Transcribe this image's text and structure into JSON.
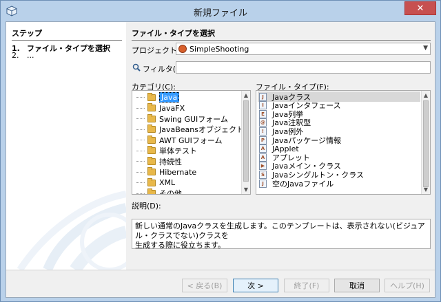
{
  "window": {
    "title": "新規ファイル",
    "close_glyph": "✕"
  },
  "steps": {
    "heading": "ステップ",
    "items": [
      {
        "num": "1.",
        "label": "ファイル・タイプを選択"
      },
      {
        "num": "2.",
        "label": "..."
      }
    ]
  },
  "main": {
    "heading": "ファイル・タイプを選択",
    "project_label": "プロジェクト(P):",
    "project_value": "SimpleShooting",
    "filter_label": "フィルタ(T):",
    "filter_value": "",
    "categories_label": "カテゴリ(C):",
    "categories": [
      "Java",
      "JavaFX",
      "Swing GUIフォーム",
      "JavaBeansオブジェクト",
      "AWT GUIフォーム",
      "単体テスト",
      "持続性",
      "Hibernate",
      "XML",
      "その他"
    ],
    "filetypes_label": "ファイル・タイプ(F):",
    "filetypes": [
      "Javaクラス",
      "Javaインタフェース",
      "Java列挙",
      "Java注釈型",
      "Java例外",
      "Javaパッケージ情報",
      "JApplet",
      "アプレット",
      "Javaメイン・クラス",
      "Javaシングルトン・クラス",
      "空のJavaファイル"
    ],
    "description_label": "説明(D):",
    "description": "新しい通常のJavaクラスを生成します。このテンプレートは、表示されない(ビジュアル・クラスでない)クラスを\n生成する際に役立ちます。"
  },
  "buttons": {
    "back": "< 戻る(B)",
    "next": "次 >",
    "finish": "終了(F)",
    "cancel": "取消",
    "help": "ヘルプ(H)"
  }
}
